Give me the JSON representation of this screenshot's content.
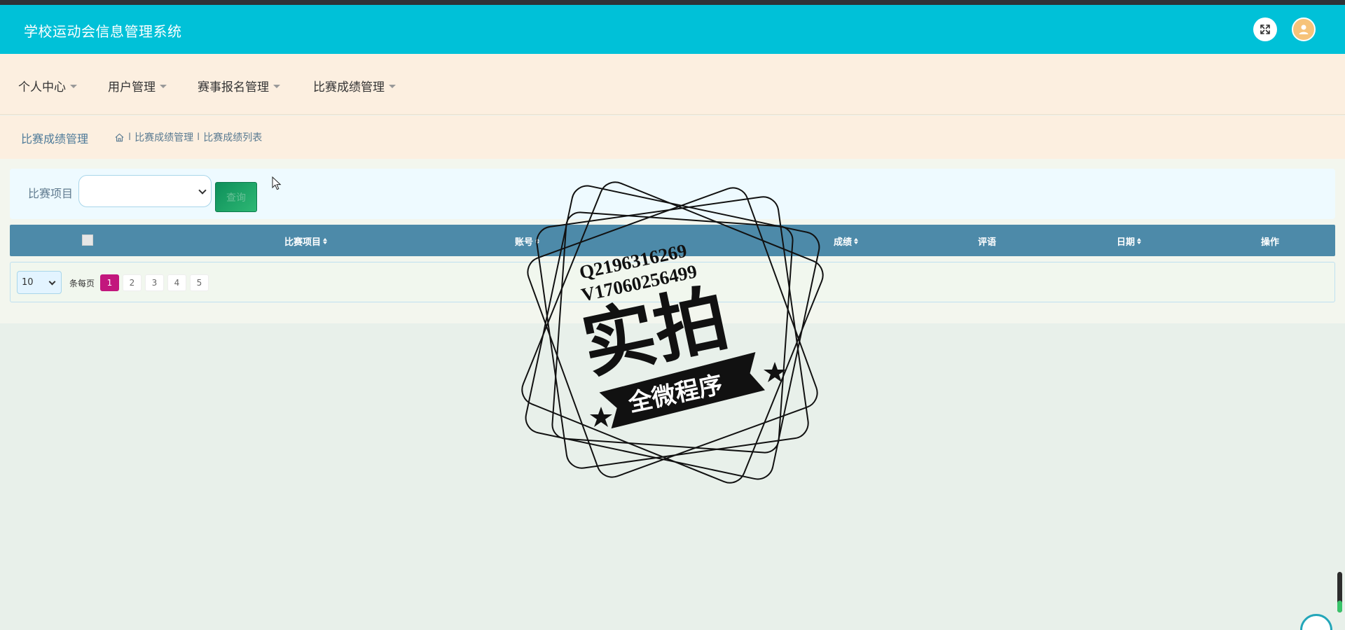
{
  "app": {
    "title": "学校运动会信息管理系统"
  },
  "header": {
    "fullscreen_icon": "fullscreen-icon",
    "avatar_icon": "avatar-icon"
  },
  "nav": {
    "items": [
      {
        "label": "个人中心"
      },
      {
        "label": "用户管理"
      },
      {
        "label": "赛事报名管理"
      },
      {
        "label": "比赛成绩管理"
      }
    ]
  },
  "breadcrumb": {
    "title": "比赛成绩管理",
    "home_icon": "home-icon",
    "items": [
      "比赛成绩管理",
      "比赛成绩列表"
    ],
    "separator": "I"
  },
  "search": {
    "label": "比赛项目",
    "selected": "",
    "button_label": "查询"
  },
  "table": {
    "columns": [
      {
        "label": "比赛项目",
        "sortable": true
      },
      {
        "label": "账号",
        "sortable": true
      },
      {
        "label": "成绩",
        "sortable": true
      },
      {
        "label": "评语",
        "sortable": false
      },
      {
        "label": "日期",
        "sortable": true
      },
      {
        "label": "操作",
        "sortable": false
      }
    ],
    "rows": []
  },
  "pagination": {
    "page_size": "10",
    "per_page_label": "条每页",
    "pages": [
      "1",
      "2",
      "3",
      "4",
      "5"
    ],
    "current": "1"
  },
  "watermark": {
    "line1": "Q2196316269",
    "line2": "V17060256499",
    "main": "实拍",
    "banner": "全微程序"
  },
  "colors": {
    "header_bg": "#00c1d8",
    "nav_bg": "#fcefe0",
    "table_head_bg": "#4d8aa9",
    "active_page": "#c2177d",
    "search_button": "#1fa36a"
  }
}
